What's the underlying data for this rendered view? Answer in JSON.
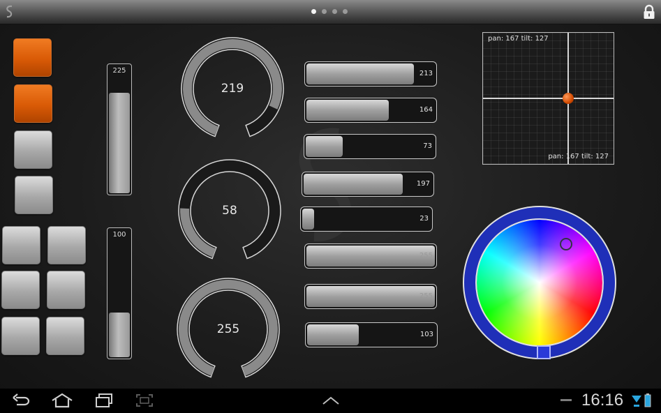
{
  "page_indicator": {
    "pages": 4,
    "active": 0
  },
  "colors": {
    "accent": "#e8650e",
    "knob_fill": "#8a8a8a",
    "color_wheel_ring": "#1f2fb8"
  },
  "buttons": [
    {
      "id": "btn1",
      "active": true
    },
    {
      "id": "btn2",
      "active": true
    },
    {
      "id": "btn3",
      "active": false
    },
    {
      "id": "btn4",
      "active": false
    },
    {
      "id": "btn5",
      "active": false
    },
    {
      "id": "btn6",
      "active": false
    },
    {
      "id": "btn7",
      "active": false
    },
    {
      "id": "btn8",
      "active": false
    },
    {
      "id": "btn9",
      "active": false
    },
    {
      "id": "btn10",
      "active": false
    }
  ],
  "vertical_faders": [
    {
      "value": "225",
      "level": 225
    },
    {
      "value": "100",
      "level": 100
    }
  ],
  "knobs": [
    {
      "value": "219",
      "level": 219
    },
    {
      "value": "58",
      "level": 58
    },
    {
      "value": "255",
      "level": 255
    }
  ],
  "horizontal_faders": [
    {
      "value": "213",
      "level": 213
    },
    {
      "value": "164",
      "level": 164
    },
    {
      "value": "73",
      "level": 73
    },
    {
      "value": "197",
      "level": 197
    },
    {
      "value": "23",
      "level": 23
    },
    {
      "value": "255",
      "level": 255
    },
    {
      "value": "255",
      "level": 255
    },
    {
      "value": "103",
      "level": 103
    }
  ],
  "xy_pad": {
    "readout_top": "pan: 167 tilt: 127",
    "readout_bottom": "pan: 167 tilt: 127",
    "pan": 167,
    "tilt": 127
  },
  "color_picker": {
    "selected": "#2a3ad8"
  },
  "statusbar": {
    "time": "16:16"
  }
}
